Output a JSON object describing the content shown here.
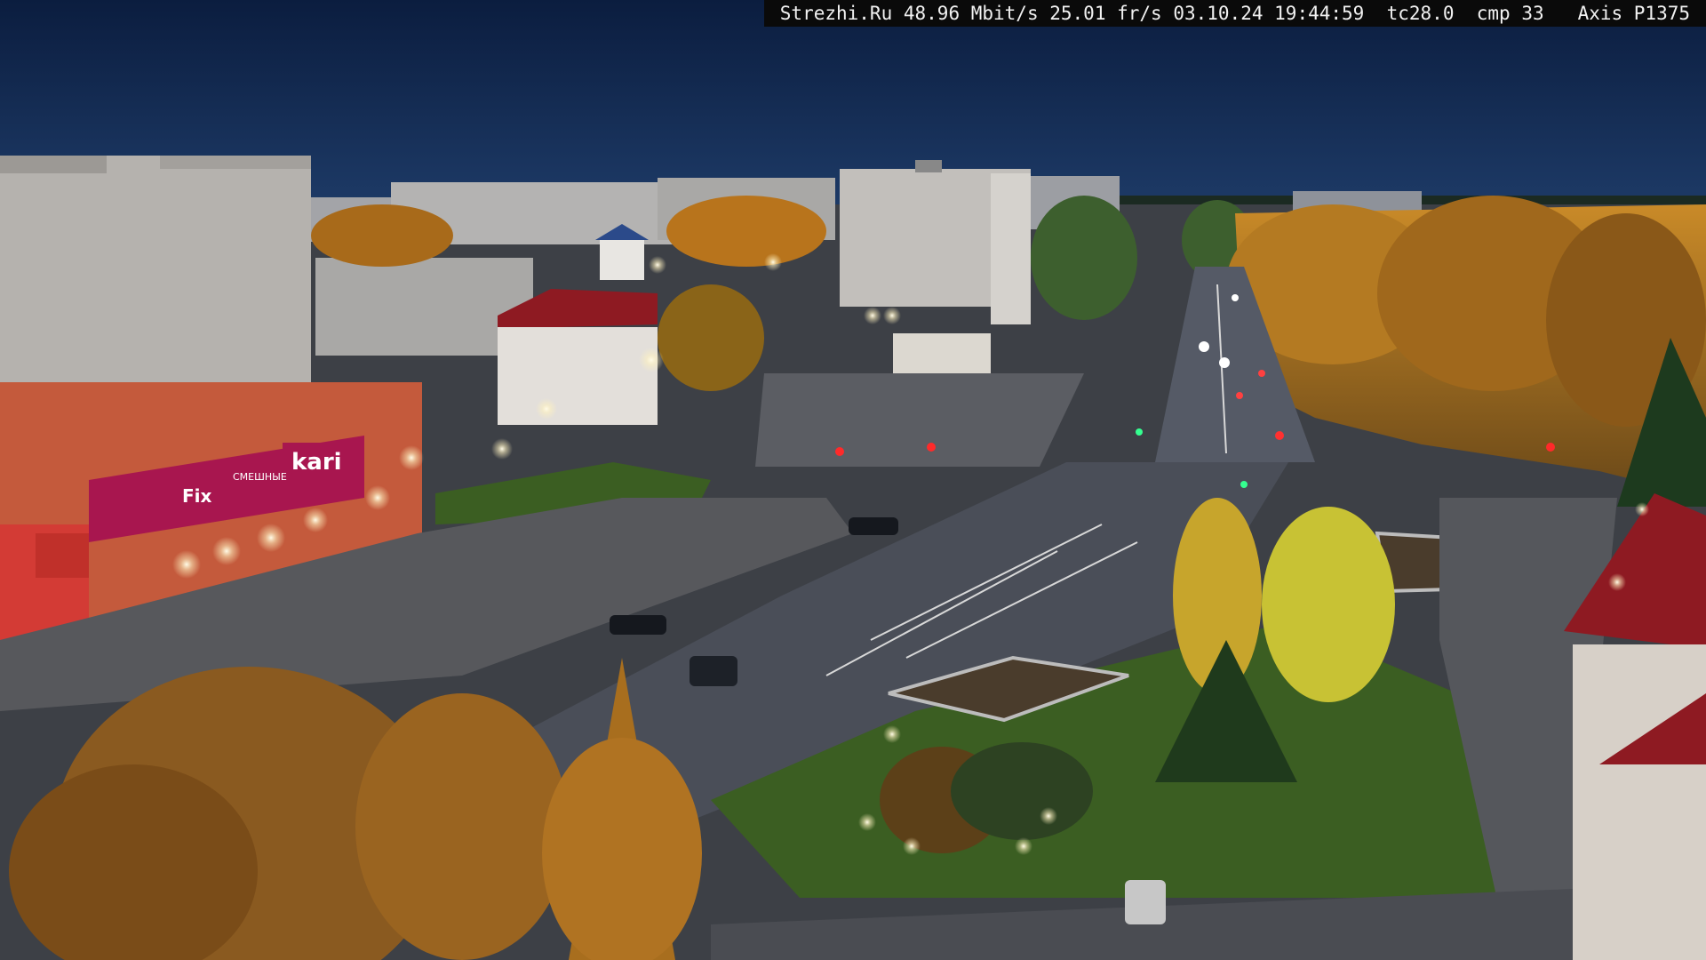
{
  "overlay": {
    "site": "Strezhi.Ru",
    "bitrate": "48.96 Mbit/s",
    "framerate": "25.01 fr/s",
    "date": "03.10.24",
    "time": "19:44:59",
    "tc": "tc28.0",
    "cmp": "cmp 33",
    "camera": "Axis P1375"
  },
  "signs": {
    "store_name": "kari",
    "shop_sign_1": "Fix",
    "shop_sign_2": "СМЕШНЫЕ"
  },
  "colors": {
    "sky_top": "#0b1d3f",
    "sky_bottom": "#1d3a66",
    "foliage": "#b8741c",
    "road": "#4a4e58",
    "grass": "#3b5e22",
    "lamp": "#fff6d8",
    "sign_magenta": "#a8164f",
    "roof_red": "#8e1a22"
  }
}
